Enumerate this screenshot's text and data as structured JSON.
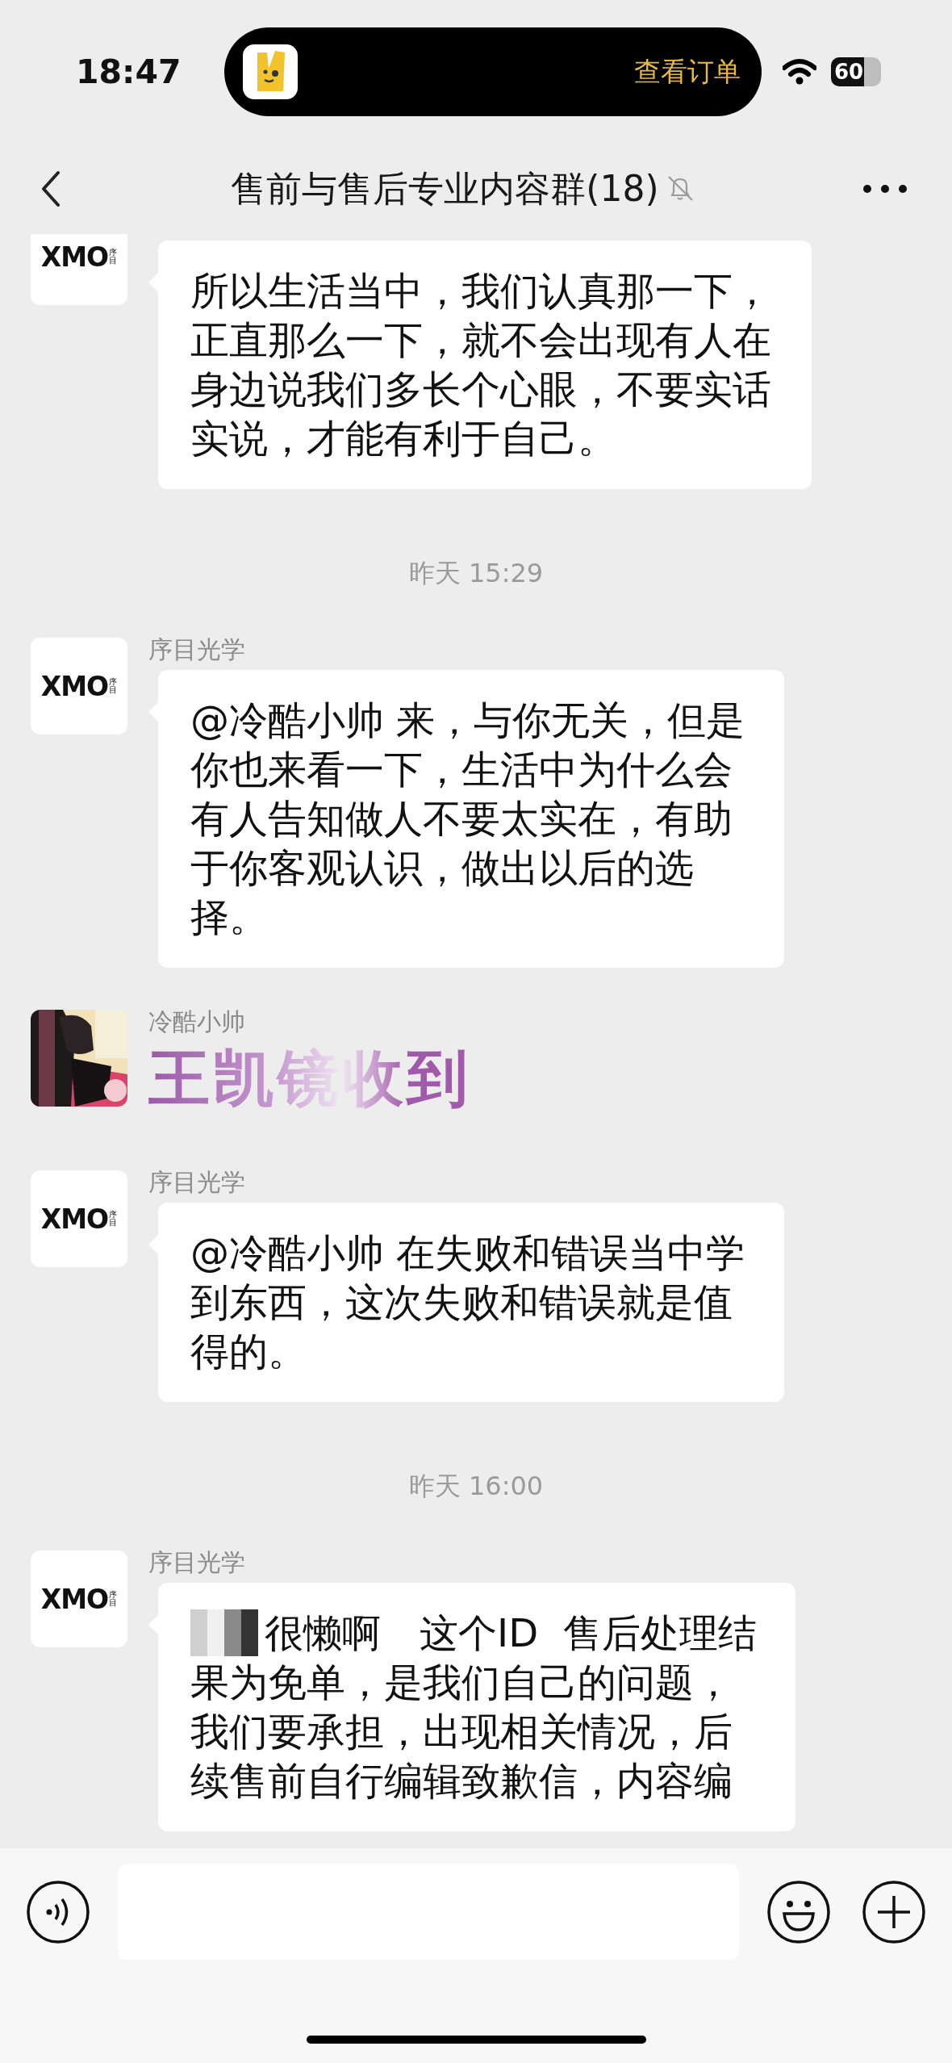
{
  "status_bar": {
    "time": "18:47",
    "island_action": "查看订单",
    "battery": "60"
  },
  "header": {
    "title": "售前与售后专业内容群(18)",
    "muted": true
  },
  "messages": [
    {
      "kind": "text",
      "avatar": {
        "kind": "logo",
        "text": "XMO",
        "sub": "序目"
      },
      "text": "所以生活当中，我们认真那一下，正直那么一下，就不会出现有人在身边说我们多长个心眼，不要实话实说，才能有利于自己。"
    },
    {
      "kind": "time",
      "text": "昨天 15:29"
    },
    {
      "kind": "text",
      "sender": "序目光学",
      "avatar": {
        "kind": "logo",
        "text": "XMO",
        "sub": "序目"
      },
      "text": "@冷酷小帅 来，与你无关，但是你也来看一下，生活中为什么会有人告知做人不要太实在，有助于你客观认识，做出以后的选择。"
    },
    {
      "kind": "sticker",
      "sender": "冷酷小帅",
      "text": "王凯镜收到"
    },
    {
      "kind": "text",
      "sender": "序目光学",
      "avatar": {
        "kind": "logo",
        "text": "XMO",
        "sub": "序目"
      },
      "text": "@冷酷小帅 在失败和错误当中学到东西，这次失败和错误就是值得的。"
    },
    {
      "kind": "time",
      "text": "昨天 16:00"
    },
    {
      "kind": "text",
      "sender": "序目光学",
      "avatar": {
        "kind": "logo",
        "text": "XMO",
        "sub": "序目"
      },
      "redacted": true,
      "text": "很懒啊　这个ID  售后处理结果为免单，是我们自己的问题，我们要承担，出现相关情况，后续售前自行编辑致歉信，内容编"
    }
  ]
}
